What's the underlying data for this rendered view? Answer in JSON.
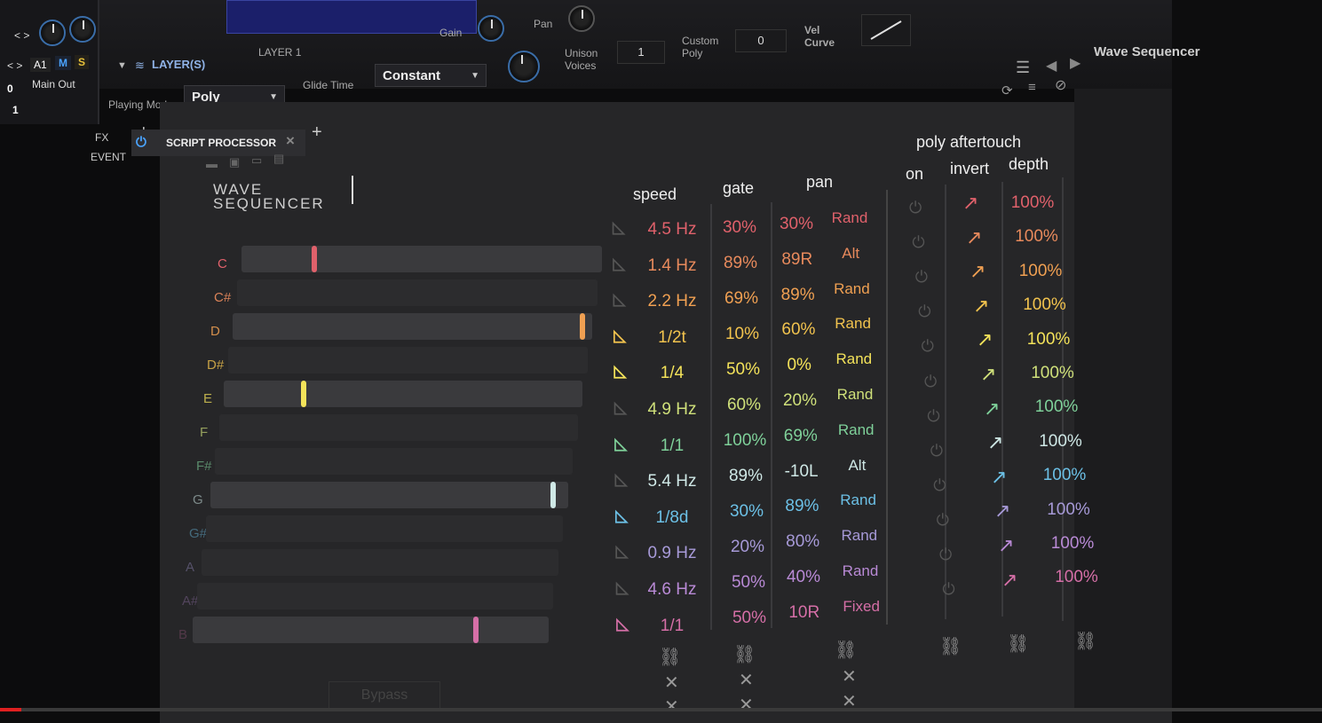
{
  "host": {
    "gain_label": "Gain",
    "pan_label": "Pan",
    "layer_header": "LAYER(S)",
    "layer_name": "LAYER 1",
    "unison_label": "Unison\nVoices",
    "unison_value": "1",
    "custom_poly_label": "Custom\nPoly",
    "custom_poly_value": "0",
    "vel_curve_label": "Vel\nCurve",
    "glide_time_label": "Glide Time",
    "glide_value": "Constant",
    "playing_mode_label": "Playing Mode",
    "playing_mode_value": "Poly",
    "left_nav": "< >",
    "a1_label": "A1",
    "m_label": "M",
    "s_label": "S",
    "zero_value": "0",
    "main_out": "Main Out",
    "one_value": "1",
    "preset_name": "Wave Sequencer"
  },
  "tabs": {
    "fx_label": "FX",
    "event_label": "EVENT",
    "script_tab": "SCRIPT PROCESSOR",
    "close_glyph": "×",
    "add_glyph": "+"
  },
  "plugin": {
    "title_line1": "WAVE",
    "title_line2": "SEQUENCER",
    "headers": {
      "speed": "speed",
      "gate": "gate",
      "pan": "pan",
      "poly_aftertouch": "poly aftertouch",
      "on": "on",
      "invert": "invert",
      "depth": "depth"
    },
    "rows": [
      {
        "note": "C",
        "color": "#e0616b",
        "speed": "4.5 Hz",
        "gate": "30%",
        "pan": "30%",
        "mode": "Rand",
        "depth": "100%",
        "marker": 0.2,
        "bar": true,
        "sync": false
      },
      {
        "note": "C#",
        "color": "#e88a5c",
        "speed": "1.4 Hz",
        "gate": "89%",
        "pan": "89R",
        "mode": "Alt",
        "depth": "100%",
        "marker": null,
        "bar": false,
        "sync": false
      },
      {
        "note": "D",
        "color": "#f0a052",
        "speed": "2.2 Hz",
        "gate": "69%",
        "pan": "89%",
        "mode": "Rand",
        "depth": "100%",
        "marker": 0.99,
        "bar": true,
        "sync": false
      },
      {
        "note": "D#",
        "color": "#f2c34e",
        "speed": "1/2t",
        "gate": "10%",
        "pan": "60%",
        "mode": "Rand",
        "depth": "100%",
        "marker": null,
        "bar": false,
        "sync": true
      },
      {
        "note": "E",
        "color": "#f4e35a",
        "speed": "1/4",
        "gate": "50%",
        "pan": "0%",
        "mode": "Rand",
        "depth": "100%",
        "marker": 0.22,
        "bar": true,
        "sync": true
      },
      {
        "note": "F",
        "color": "#cfe07a",
        "speed": "4.9 Hz",
        "gate": "60%",
        "pan": "20%",
        "mode": "Rand",
        "depth": "100%",
        "marker": null,
        "bar": false,
        "sync": false
      },
      {
        "note": "F#",
        "color": "#7fd19a",
        "speed": "1/1",
        "gate": "100%",
        "pan": "69%",
        "mode": "Rand",
        "depth": "100%",
        "marker": null,
        "bar": false,
        "sync": true
      },
      {
        "note": "G",
        "color": "#cfe8e6",
        "speed": "5.4 Hz",
        "gate": "89%",
        "pan": "-10L",
        "mode": "Alt",
        "depth": "100%",
        "marker": 0.97,
        "bar": true,
        "sync": false
      },
      {
        "note": "G#",
        "color": "#6cc0e6",
        "speed": "1/8d",
        "gate": "30%",
        "pan": "89%",
        "mode": "Rand",
        "depth": "100%",
        "marker": null,
        "bar": false,
        "sync": true
      },
      {
        "note": "A",
        "color": "#a79ad8",
        "speed": "0.9 Hz",
        "gate": "20%",
        "pan": "80%",
        "mode": "Rand",
        "depth": "100%",
        "marker": null,
        "bar": false,
        "sync": false
      },
      {
        "note": "A#",
        "color": "#b98ad6",
        "speed": "4.6 Hz",
        "gate": "50%",
        "pan": "40%",
        "mode": "Rand",
        "depth": "100%",
        "marker": null,
        "bar": false,
        "sync": false
      },
      {
        "note": "B",
        "color": "#d56fa7",
        "speed": "1/1",
        "gate": "50%",
        "pan": "10R",
        "mode": "Fixed",
        "depth": "100%",
        "marker": 0.8,
        "bar": true,
        "sync": true
      }
    ],
    "bypass_label": "Bypass"
  }
}
